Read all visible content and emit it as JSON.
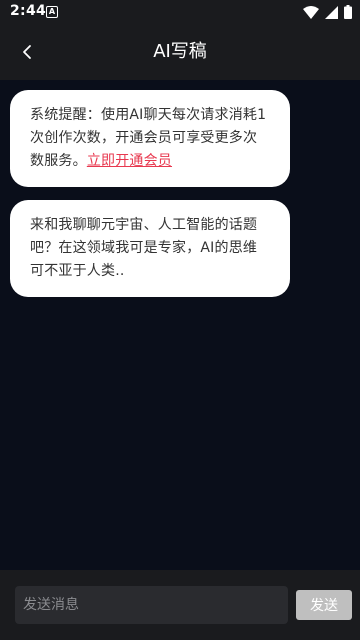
{
  "status_bar": {
    "time": "2:44",
    "notification_icon_glyph": "A",
    "icons": [
      "notification-icon",
      "wifi-icon",
      "signal-icon",
      "battery-icon"
    ]
  },
  "header": {
    "title": "AI写稿",
    "back_icon": "chevron-left-icon"
  },
  "messages": [
    {
      "text": "系统提醒：使用AI聊天每次请求消耗1次创作次数，开通会员可享受更多次数服务。",
      "link_text": "立即开通会员",
      "link_color": "#e8384f"
    },
    {
      "text": "来和我聊聊元宇宙、人工智能的话题吧？在这领域我可是专家，AI的思维可不亚于人类.."
    }
  ],
  "composer": {
    "placeholder": "发送消息",
    "value": "",
    "send_label": "发送"
  },
  "colors": {
    "background": "#0a0e1a",
    "bar": "#1a1b1e",
    "bubble": "#ffffff",
    "send_button": "#bfbfbf"
  }
}
